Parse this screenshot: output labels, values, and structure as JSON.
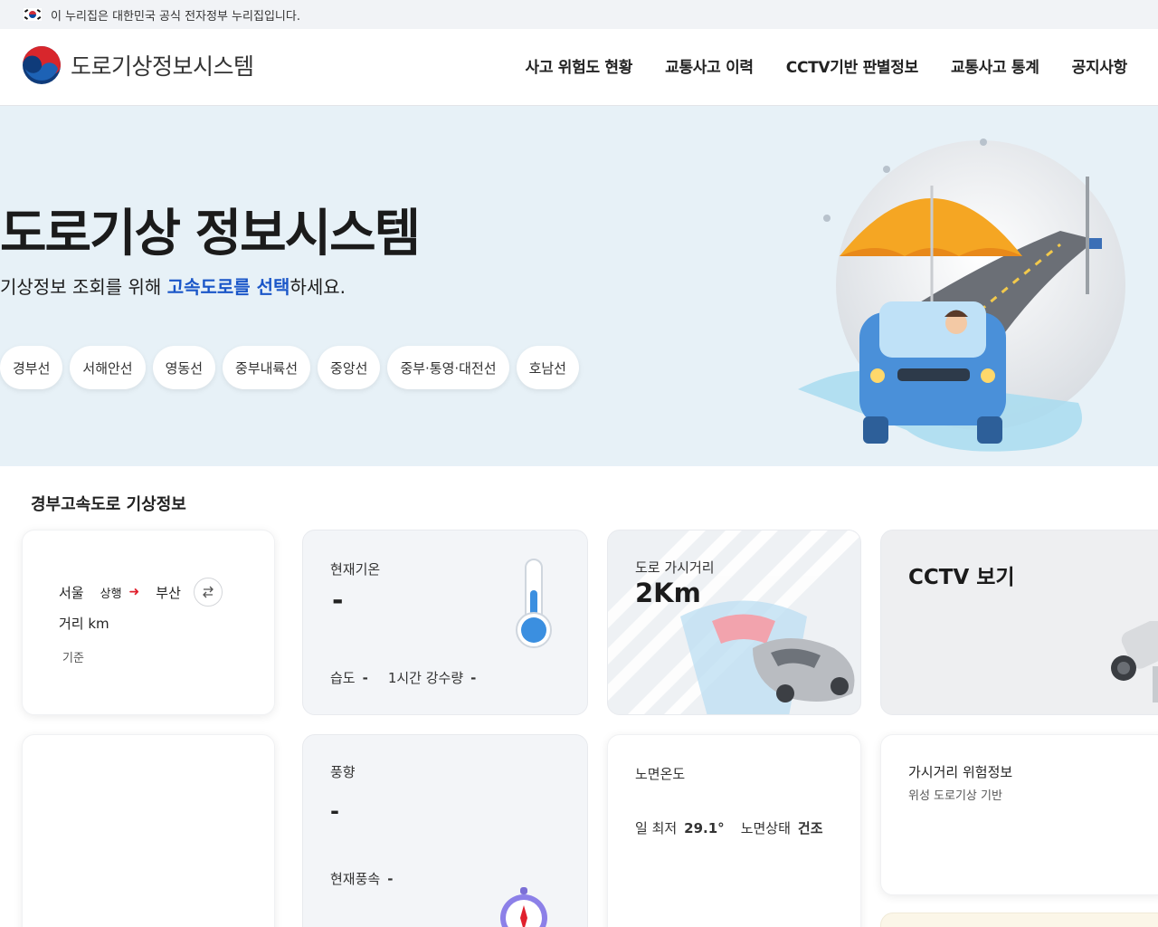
{
  "gov_banner": {
    "text": "이 누리집은 대한민국 공식 전자정부 누리집입니다."
  },
  "header": {
    "logo_text": "도로기상정보시스템",
    "nav": [
      "사고 위험도 현황",
      "교통사고 이력",
      "CCTV기반 판별정보",
      "교통사고 통계",
      "공지사항"
    ]
  },
  "hero": {
    "title": "도로기상 정보시스템",
    "sub_before": "기상정보 조회를 위해 ",
    "sub_highlight": "고속도로를 선택",
    "sub_after": "하세요.",
    "chips": [
      "경부선",
      "서해안선",
      "영동선",
      "중부내륙선",
      "중앙선",
      "중부·통영·대전선",
      "호남선"
    ]
  },
  "section": {
    "title": "경부고속도로 기상정보"
  },
  "route_card": {
    "origin": "서울",
    "direction": "상행",
    "destination": "부산",
    "distance": "거리 km",
    "basis": "기준"
  },
  "temp_card": {
    "label": "현재기온",
    "value": "-",
    "humidity_label": "습도",
    "humidity_value": "-",
    "rain_label": "1시간 강수량",
    "rain_value": "-"
  },
  "visibility_card": {
    "label": "도로 가시거리",
    "value": "2Km"
  },
  "cctv_card": {
    "title": "CCTV 보기"
  },
  "wind_card": {
    "label": "풍향",
    "value": "-",
    "speed_label": "현재풍속",
    "speed_value": "-"
  },
  "road_temp_card": {
    "label": "노면온도",
    "min_label": "일 최저",
    "min_value": "29.1°",
    "state_label": "노면상태",
    "state_value": "건조"
  },
  "hazard_card": {
    "title": "가시거리 위험정보",
    "subtitle": "위성 도로기상 기반"
  },
  "colors": {
    "accent": "#1a56c8",
    "hero_bg": "#e7f1f7",
    "arrow_red": "#e0202d"
  }
}
